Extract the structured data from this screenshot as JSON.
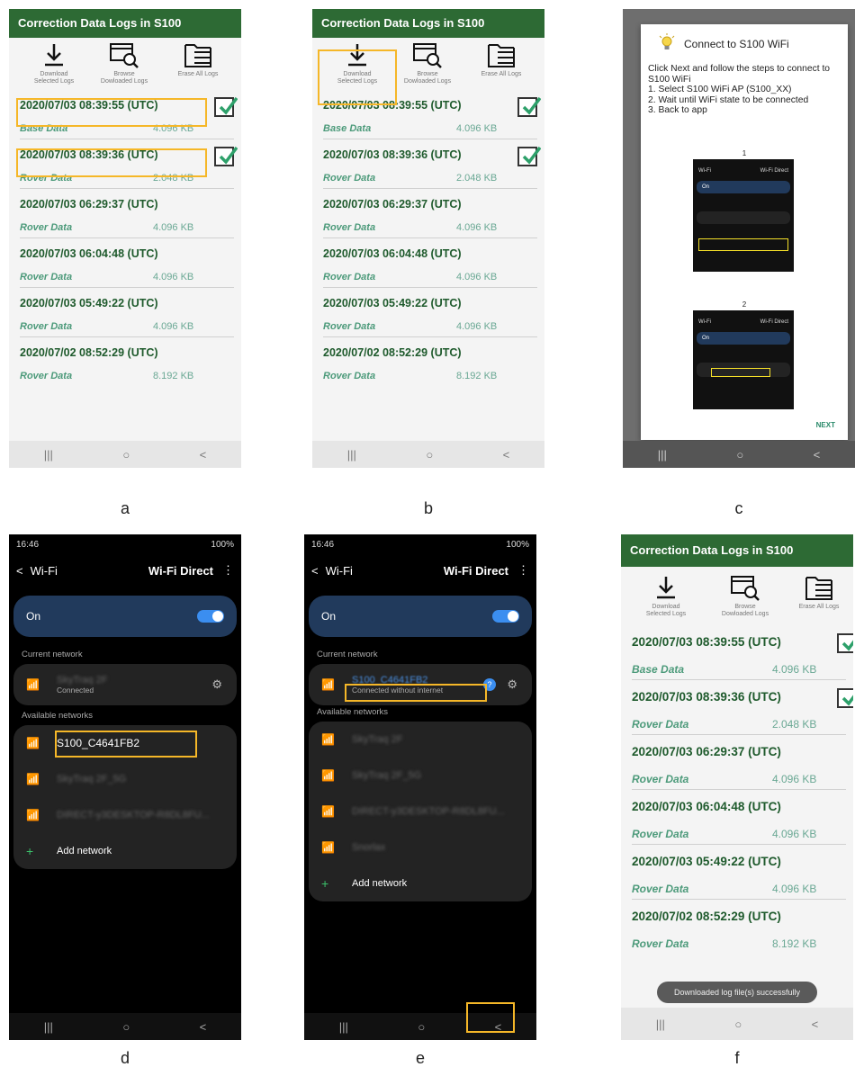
{
  "labels": {
    "a": "a",
    "b": "b",
    "c": "c",
    "d": "d",
    "e": "e",
    "f": "f"
  },
  "app": {
    "title": "Correction Data Logs in S100",
    "download_label_1": "Download",
    "download_label_2": "Selected Logs",
    "browse_label_1": "Browse",
    "browse_label_2": "Dowloaded Logs",
    "erase_label": "Erase All Logs",
    "logs": [
      {
        "time": "2020/07/03 08:39:55 (UTC)",
        "type": "Base Data",
        "size": "4.096 KB"
      },
      {
        "time": "2020/07/03 08:39:36 (UTC)",
        "type": "Rover Data",
        "size": "2.048 KB"
      },
      {
        "time": "2020/07/03 06:29:37 (UTC)",
        "type": "Rover Data",
        "size": "4.096 KB"
      },
      {
        "time": "2020/07/03 06:04:48 (UTC)",
        "type": "Rover Data",
        "size": "4.096 KB"
      },
      {
        "time": "2020/07/03 05:49:22 (UTC)",
        "type": "Rover Data",
        "size": "4.096 KB"
      },
      {
        "time": "2020/07/02 08:52:29 (UTC)",
        "type": "Rover Data",
        "size": "8.192 KB"
      }
    ],
    "nav": {
      "recent": "|||",
      "home": "○",
      "back": "<"
    },
    "toast": "Downloaded log file(s) successfully"
  },
  "dialog": {
    "title": "Connect to S100 WiFi",
    "body": "Click Next and follow the steps to connect to S100 WiFi\n1. Select S100 WiFi AP (S100_XX)\n2. Wait until WiFi state to be connected\n3. Back to app",
    "step1": "1",
    "step2": "2",
    "next": "NEXT",
    "thumb_wifi": "Wi-Fi",
    "thumb_direct": "Wi-Fi Direct",
    "thumb_on": "On"
  },
  "wifi": {
    "time": "16:46",
    "status_right": "100%",
    "back": "<",
    "title": "Wi-Fi",
    "direct": "Wi-Fi Direct",
    "menu": "⋮",
    "on": "On",
    "current_network": "Current network",
    "available_networks": "Available networks",
    "connected": "Connected",
    "connected_no_internet": "Connected without internet",
    "current_name_d": "SkyTraq 2F",
    "current_name_e": "S100_C4641FB2",
    "target": "S100_C4641FB2",
    "nets_d": [
      "SkyTraq 2F_5G",
      "DIRECT-y3DESKTOP-R8DL8FU..."
    ],
    "nets_e": [
      "SkyTraq 2F",
      "SkyTraq 2F_5G",
      "DIRECT-y3DESKTOP-R8DL8FU...",
      "Snorlax"
    ],
    "add_network": "Add network"
  },
  "colors": {
    "header": "#2d6a34",
    "highlight": "#f5b728",
    "title_green": "#1e5a2c"
  }
}
